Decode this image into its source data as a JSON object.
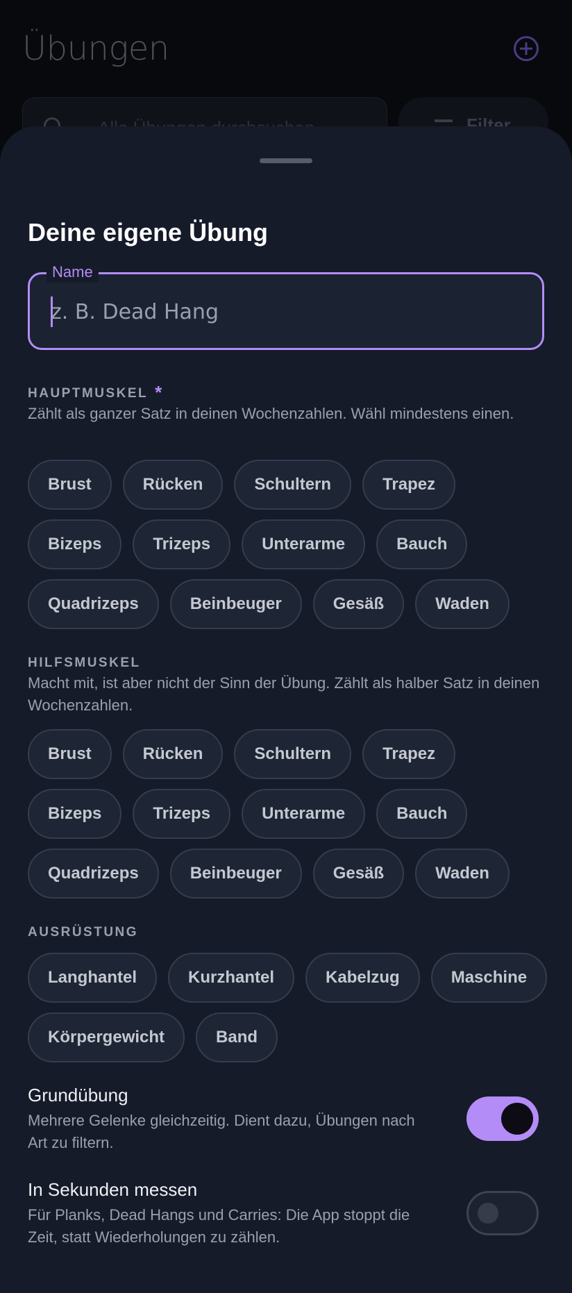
{
  "background": {
    "title": "Übungen",
    "search_placeholder": "Alle Übungen durchsuchen",
    "filter_label": "Filter"
  },
  "sheet": {
    "title": "Deine eigene Übung",
    "name_field": {
      "label": "Name",
      "placeholder": "z. B. Dead Hang",
      "value": ""
    },
    "primary_muscle": {
      "label": "HAUPTMUSKEL",
      "required_mark": "*",
      "description": "Zählt als ganzer Satz in deinen Wochenzahlen. Wähl mindestens einen.",
      "options": [
        "Brust",
        "Rücken",
        "Schultern",
        "Trapez",
        "Bizeps",
        "Trizeps",
        "Unterarme",
        "Bauch",
        "Quadrizeps",
        "Beinbeuger",
        "Gesäß",
        "Waden"
      ]
    },
    "secondary_muscle": {
      "label": "HILFSMUSKEL",
      "description": "Macht mit, ist aber nicht der Sinn der Übung. Zählt als halber Satz in deinen Wochenzahlen.",
      "options": [
        "Brust",
        "Rücken",
        "Schultern",
        "Trapez",
        "Bizeps",
        "Trizeps",
        "Unterarme",
        "Bauch",
        "Quadrizeps",
        "Beinbeuger",
        "Gesäß",
        "Waden"
      ]
    },
    "equipment": {
      "label": "AUSRÜSTUNG",
      "options": [
        "Langhantel",
        "Kurzhantel",
        "Kabelzug",
        "Maschine",
        "Körpergewicht",
        "Band"
      ]
    },
    "compound": {
      "title": "Grundübung",
      "description": "Mehrere Gelenke gleichzeitig. Dient dazu, Übungen nach Art zu filtern.",
      "enabled": true
    },
    "timed": {
      "title": "In Sekunden messen",
      "description": "Für Planks, Dead Hangs und Carries: Die App stoppt die Zeit, statt Wiederholungen zu zählen.",
      "enabled": false
    }
  },
  "colors": {
    "accent": "#b48cf7",
    "sheet": "#151b29",
    "chip": "#1e2535"
  }
}
